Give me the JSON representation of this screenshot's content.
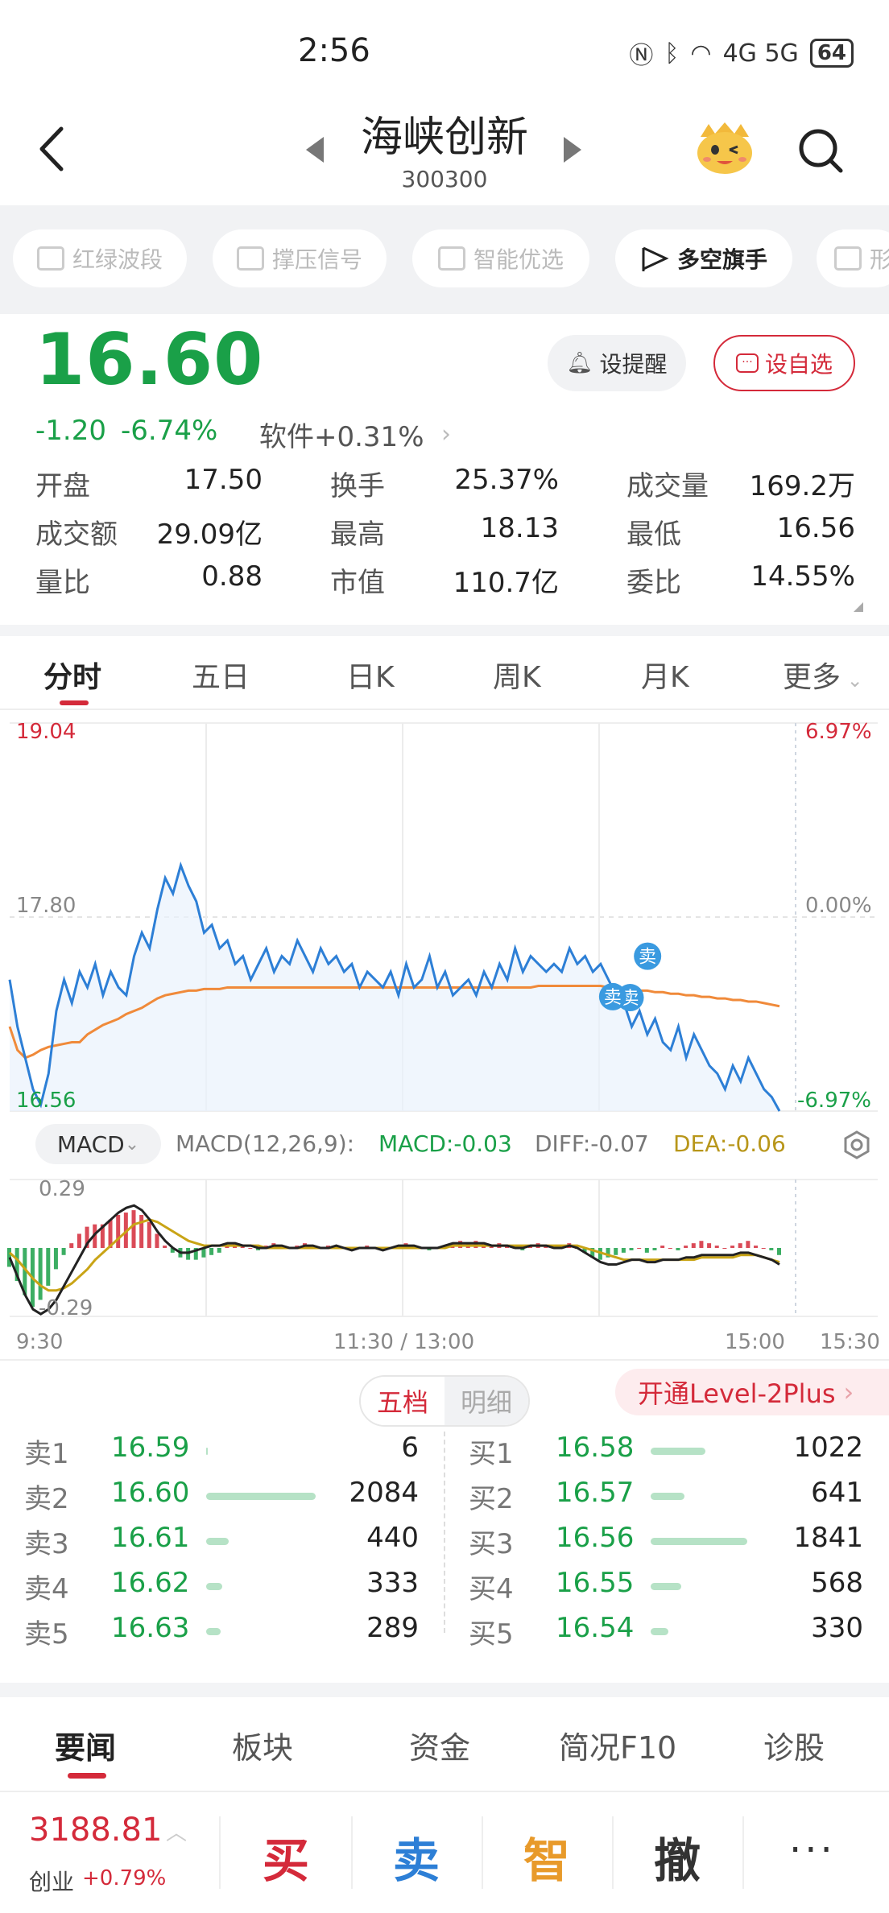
{
  "status_bar": {
    "time": "2:56",
    "network": "4G 5G",
    "battery": "64"
  },
  "header": {
    "stock_name": "海峡创新",
    "stock_code": "300300"
  },
  "chips": [
    {
      "label": "红绿波段",
      "locked": true
    },
    {
      "label": "撑压信号",
      "locked": true
    },
    {
      "label": "智能优选",
      "locked": true
    },
    {
      "label": "多空旗手",
      "locked": false
    },
    {
      "label": "形",
      "locked": true
    }
  ],
  "quote": {
    "price": "16.60",
    "change": "-1.20",
    "change_pct": "-6.74%",
    "sector": "软件+0.31%",
    "alert_label": "设提醒",
    "watch_label": "设自选",
    "stats": [
      {
        "label": "开盘",
        "value": "17.50",
        "color": "green"
      },
      {
        "label": "换手",
        "value": "25.37%",
        "color": "black"
      },
      {
        "label": "成交量",
        "value": "169.2万",
        "color": "black"
      },
      {
        "label": "成交额",
        "value": "29.09亿",
        "color": "black"
      },
      {
        "label": "最高",
        "value": "18.13",
        "color": "red"
      },
      {
        "label": "最低",
        "value": "16.56",
        "color": "green"
      },
      {
        "label": "量比",
        "value": "0.88",
        "color": "black"
      },
      {
        "label": "市值",
        "value": "110.7亿",
        "color": "black"
      },
      {
        "label": "委比",
        "value": "14.55%",
        "color": "red"
      }
    ]
  },
  "chart_tabs": [
    "分时",
    "五日",
    "日K",
    "周K",
    "月K",
    "更多"
  ],
  "chart_data": [
    {
      "type": "line",
      "x": [
        "9:30",
        "11:30 / 13:00",
        "15:00"
      ],
      "ylim": [
        16.56,
        19.04
      ],
      "y_tick_labels": [
        "19.04",
        "17.80",
        "16.56"
      ],
      "right_tick_labels": [
        "6.97%",
        "0.00%",
        "-6.97%"
      ],
      "sell_markers": [
        "卖",
        "卖",
        "卖"
      ],
      "series": [
        {
          "values": [
            17.4,
            17.1,
            16.9,
            16.7,
            16.6,
            16.8,
            17.2,
            17.4,
            17.25,
            17.45,
            17.35,
            17.5,
            17.3,
            17.45,
            17.35,
            17.3,
            17.55,
            17.7,
            17.6,
            17.85,
            18.05,
            17.95,
            18.13,
            18.0,
            17.9,
            17.7,
            17.75,
            17.6,
            17.65,
            17.5,
            17.55,
            17.4,
            17.5,
            17.6,
            17.45,
            17.55,
            17.5,
            17.65,
            17.55,
            17.45,
            17.6,
            17.5,
            17.55,
            17.45,
            17.5,
            17.35,
            17.45,
            17.4,
            17.35,
            17.45,
            17.3,
            17.5,
            17.35,
            17.4,
            17.55,
            17.35,
            17.45,
            17.3,
            17.35,
            17.4,
            17.3,
            17.45,
            17.35,
            17.5,
            17.4,
            17.6,
            17.45,
            17.55,
            17.5,
            17.45,
            17.5,
            17.45,
            17.6,
            17.5,
            17.55,
            17.45,
            17.5,
            17.4,
            17.3,
            17.25,
            17.1,
            17.2,
            17.05,
            17.15,
            17.0,
            16.95,
            17.1,
            16.9,
            17.05,
            16.95,
            16.85,
            16.8,
            16.7,
            16.85,
            16.75,
            16.9,
            16.8,
            16.7,
            16.65,
            16.56
          ]
        },
        {
          "values": [
            17.1,
            16.95,
            16.9,
            16.92,
            16.95,
            16.97,
            16.98,
            16.99,
            17.0,
            17.0,
            17.05,
            17.08,
            17.11,
            17.13,
            17.15,
            17.18,
            17.2,
            17.22,
            17.25,
            17.28,
            17.3,
            17.31,
            17.32,
            17.33,
            17.33,
            17.34,
            17.34,
            17.34,
            17.35,
            17.35,
            17.35,
            17.35,
            17.35,
            17.35,
            17.35,
            17.35,
            17.35,
            17.35,
            17.35,
            17.35,
            17.35,
            17.35,
            17.35,
            17.35,
            17.35,
            17.35,
            17.35,
            17.35,
            17.35,
            17.35,
            17.35,
            17.35,
            17.35,
            17.35,
            17.35,
            17.35,
            17.35,
            17.35,
            17.35,
            17.35,
            17.35,
            17.35,
            17.35,
            17.35,
            17.35,
            17.35,
            17.35,
            17.35,
            17.36,
            17.36,
            17.36,
            17.36,
            17.36,
            17.36,
            17.36,
            17.36,
            17.36,
            17.35,
            17.35,
            17.34,
            17.34,
            17.33,
            17.33,
            17.32,
            17.32,
            17.31,
            17.31,
            17.3,
            17.3,
            17.29,
            17.29,
            17.28,
            17.28,
            17.27,
            17.27,
            17.26,
            17.26,
            17.25,
            17.24,
            17.23
          ]
        }
      ]
    },
    {
      "type": "bar",
      "title": "MACD(12,26,9):",
      "ylim": [
        -0.29,
        0.29
      ],
      "y_tick_labels": [
        "0.29",
        "-0.29"
      ],
      "series": [
        {
          "name": "MACD",
          "values": [
            -0.08,
            -0.14,
            -0.2,
            -0.25,
            -0.22,
            -0.16,
            -0.09,
            -0.03,
            0.02,
            0.06,
            0.09,
            0.1,
            0.1,
            0.12,
            0.14,
            0.15,
            0.16,
            0.14,
            0.11,
            0.06,
            0.01,
            -0.02,
            -0.04,
            -0.05,
            -0.05,
            -0.04,
            -0.03,
            -0.02,
            0.01,
            0.02,
            0.01,
            0.0,
            -0.01,
            0.01,
            0.02,
            0.01,
            0.0,
            0.01,
            0.02,
            0.01,
            0.0,
            0.01,
            0.01,
            0.0,
            -0.01,
            0.0,
            0.01,
            0.0,
            -0.01,
            0.0,
            0.01,
            0.02,
            0.01,
            0.0,
            -0.01,
            0.0,
            0.01,
            0.02,
            0.03,
            0.02,
            0.03,
            0.02,
            0.01,
            0.02,
            0.01,
            0.0,
            -0.01,
            0.01,
            0.02,
            0.01,
            0.0,
            0.01,
            0.02,
            0.0,
            -0.02,
            -0.04,
            -0.05,
            -0.04,
            -0.03,
            -0.02,
            -0.01,
            0.0,
            -0.02,
            -0.01,
            0.01,
            0.0,
            -0.01,
            0.01,
            0.02,
            0.03,
            0.02,
            0.01,
            0.0,
            0.01,
            0.02,
            0.03,
            0.01,
            0.0,
            -0.01,
            -0.03
          ]
        },
        {
          "name": "DIFF",
          "values": [
            -0.04,
            -0.12,
            -0.2,
            -0.26,
            -0.28,
            -0.26,
            -0.22,
            -0.16,
            -0.1,
            -0.04,
            0.02,
            0.06,
            0.09,
            0.12,
            0.15,
            0.17,
            0.18,
            0.16,
            0.12,
            0.07,
            0.03,
            0.0,
            -0.02,
            -0.02,
            -0.01,
            0.0,
            0.01,
            0.01,
            0.02,
            0.02,
            0.01,
            0.01,
            0.0,
            0.0,
            0.01,
            0.01,
            0.0,
            0.0,
            0.01,
            0.01,
            0.0,
            0.0,
            0.01,
            0.0,
            -0.01,
            0.0,
            0.0,
            0.0,
            -0.01,
            0.0,
            0.01,
            0.01,
            0.01,
            0.0,
            0.0,
            0.0,
            0.01,
            0.02,
            0.02,
            0.02,
            0.02,
            0.02,
            0.01,
            0.01,
            0.01,
            0.0,
            0.0,
            0.01,
            0.01,
            0.01,
            0.0,
            0.0,
            0.01,
            0.0,
            -0.02,
            -0.04,
            -0.06,
            -0.07,
            -0.07,
            -0.06,
            -0.05,
            -0.05,
            -0.06,
            -0.06,
            -0.05,
            -0.05,
            -0.05,
            -0.04,
            -0.04,
            -0.03,
            -0.03,
            -0.03,
            -0.03,
            -0.03,
            -0.02,
            -0.02,
            -0.03,
            -0.04,
            -0.05,
            -0.07
          ]
        },
        {
          "name": "DEA",
          "values": [
            -0.02,
            -0.05,
            -0.09,
            -0.13,
            -0.16,
            -0.18,
            -0.18,
            -0.17,
            -0.15,
            -0.12,
            -0.09,
            -0.05,
            -0.02,
            0.01,
            0.04,
            0.07,
            0.1,
            0.11,
            0.12,
            0.11,
            0.09,
            0.07,
            0.05,
            0.03,
            0.02,
            0.01,
            0.01,
            0.01,
            0.01,
            0.01,
            0.01,
            0.01,
            0.01,
            0.0,
            0.0,
            0.0,
            0.0,
            0.0,
            0.0,
            0.0,
            0.0,
            0.0,
            0.0,
            0.0,
            0.0,
            0.0,
            0.0,
            0.0,
            0.0,
            0.0,
            0.0,
            0.0,
            0.0,
            0.0,
            0.0,
            0.0,
            0.0,
            0.01,
            0.01,
            0.01,
            0.01,
            0.01,
            0.01,
            0.01,
            0.01,
            0.01,
            0.01,
            0.01,
            0.01,
            0.01,
            0.01,
            0.01,
            0.01,
            0.01,
            0.0,
            -0.01,
            -0.02,
            -0.03,
            -0.04,
            -0.05,
            -0.05,
            -0.05,
            -0.05,
            -0.05,
            -0.05,
            -0.05,
            -0.05,
            -0.05,
            -0.05,
            -0.04,
            -0.04,
            -0.04,
            -0.04,
            -0.04,
            -0.03,
            -0.03,
            -0.03,
            -0.04,
            -0.05,
            -0.06
          ]
        }
      ]
    }
  ],
  "macd": {
    "selector": "MACD",
    "title": "MACD(12,26,9):",
    "macd": "MACD:-0.03",
    "diff": "DIFF:-0.07",
    "dea": "DEA:-0.06"
  },
  "time_axis": [
    "9:30",
    "11:30 / 13:00",
    "15:00",
    "15:30"
  ],
  "order_book": {
    "tab_five": "五档",
    "tab_detail": "明细",
    "level2": "开通Level-2Plus",
    "sells": [
      {
        "label": "卖1",
        "price": "16.59",
        "qty": "6"
      },
      {
        "label": "卖2",
        "price": "16.60",
        "qty": "2084"
      },
      {
        "label": "卖3",
        "price": "16.61",
        "qty": "440"
      },
      {
        "label": "卖4",
        "price": "16.62",
        "qty": "333"
      },
      {
        "label": "卖5",
        "price": "16.63",
        "qty": "289"
      }
    ],
    "buys": [
      {
        "label": "买1",
        "price": "16.58",
        "qty": "1022"
      },
      {
        "label": "买2",
        "price": "16.57",
        "qty": "641"
      },
      {
        "label": "买3",
        "price": "16.56",
        "qty": "1841"
      },
      {
        "label": "买4",
        "price": "16.55",
        "qty": "568"
      },
      {
        "label": "买5",
        "price": "16.54",
        "qty": "330"
      }
    ]
  },
  "bottom_tabs": [
    "要闻",
    "板块",
    "资金",
    "简况F10",
    "诊股"
  ],
  "action_bar": {
    "index_value": "3188.81",
    "index_name": "创业",
    "index_change": "+0.79%",
    "buy": "买",
    "sell": "卖",
    "smart": "智",
    "cancel": "撤",
    "more": "···"
  },
  "colors": {
    "green": "#1aa048",
    "red": "#d42a3a",
    "price_line": "#2d7fd6",
    "avg_line": "#f08a3a",
    "dea_line": "#c9a416",
    "marker_blue": "#3a9ae0"
  }
}
